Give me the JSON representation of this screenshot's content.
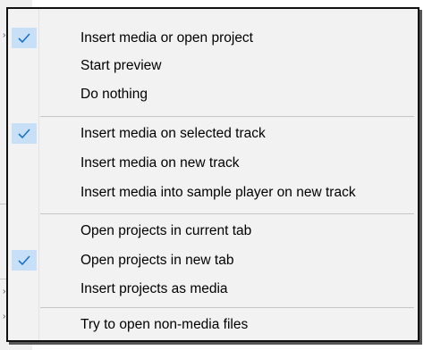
{
  "menu": {
    "items": [
      {
        "label": "Insert media or open project",
        "checked": true
      },
      {
        "label": "Start preview",
        "checked": false
      },
      {
        "label": "Do nothing",
        "checked": false
      },
      {
        "label": "Insert media on selected track",
        "checked": true
      },
      {
        "label": "Insert media on new track",
        "checked": false
      },
      {
        "label": "Insert media into sample player on new track",
        "checked": false
      },
      {
        "label": "Open projects in current tab",
        "checked": false
      },
      {
        "label": "Open projects in new tab",
        "checked": true
      },
      {
        "label": "Insert projects as media",
        "checked": false
      },
      {
        "label": "Try to open non-media files",
        "checked": false
      }
    ]
  },
  "colors": {
    "check_highlight": "#c7e0f7",
    "check_mark": "#1c72c4",
    "menu_background": "#f2f2f2",
    "separator": "#c6c6c6"
  },
  "icons": {
    "check": "checkmark-icon",
    "submenu_arrow": "chevron-right-icon"
  }
}
